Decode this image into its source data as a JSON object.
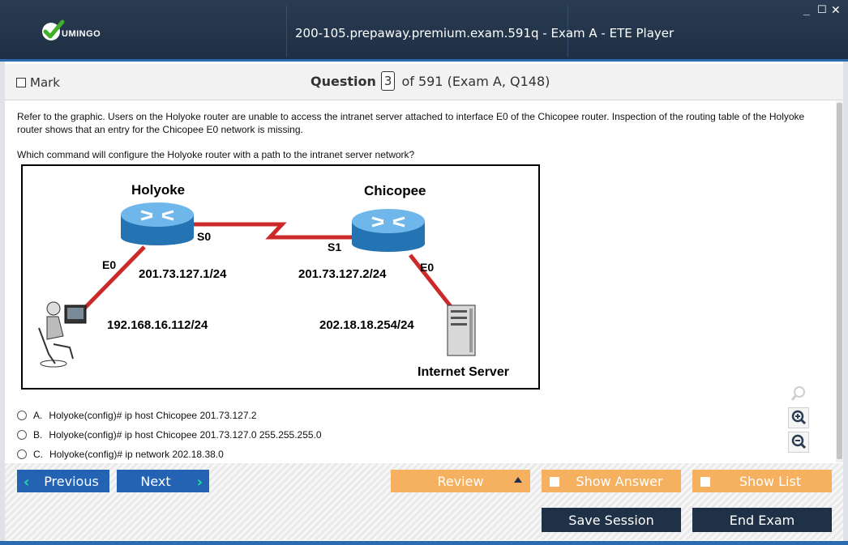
{
  "app": {
    "logo_text": "UMINGO",
    "window_title": "200-105.prepaway.premium.exam.591q - Exam A - ETE Player",
    "controls": {
      "minimize": "_",
      "maximize": "☐",
      "close": "✕"
    }
  },
  "header": {
    "mark_label": "Mark",
    "question_label": "Question",
    "question_number": "3",
    "question_of": "of 591 (Exam A, Q148)"
  },
  "question": {
    "text": "Refer to the graphic. Users on the Holyoke router are unable to access the intranet server attached to interface E0 of the Chicopee router. Inspection of the routing table of the Holyoke router shows that an entry for the Chicopee E0 network is missing.",
    "prompt": "Which command will configure the Holyoke router with a path to the intranet server network?"
  },
  "diagram": {
    "router1_name": "Holyoke",
    "router2_name": "Chicopee",
    "r1_serial": "S0",
    "r2_serial": "S1",
    "r1_eth": "E0",
    "r2_eth": "E0",
    "r1_serial_ip": "201.73.127.1/24",
    "r2_serial_ip": "201.73.127.2/24",
    "host_ip": "192.168.16.112/24",
    "server_gw_ip": "202.18.18.254/24",
    "server_label": "Internet Server"
  },
  "answers": [
    {
      "letter": "A.",
      "text": "Holyoke(config)# ip host Chicopee 201.73.127.2"
    },
    {
      "letter": "B.",
      "text": "Holyoke(config)# ip host Chicopee 201.73.127.0 255.255.255.0"
    },
    {
      "letter": "C.",
      "text": "Holyoke(config)# ip network 202.18.38.0"
    }
  ],
  "footer": {
    "previous": "Previous",
    "next": "Next",
    "review": "Review",
    "show_answer": "Show Answer",
    "show_list": "Show List",
    "save_session": "Save Session",
    "end_exam": "End Exam"
  },
  "icons": {
    "logo": "checkmark-logo-icon",
    "zoom_fit": "magnifier-icon",
    "zoom_in": "zoom-in-icon",
    "zoom_out": "zoom-out-icon"
  },
  "colors": {
    "titlebar": "#1f3045",
    "accent": "#2b6cb0",
    "nav_button": "#2463b4",
    "orange_button": "#f5b060",
    "dark_button": "#1f3146",
    "link_red": "#cc2a2a",
    "router_blue": "#2f8ccf"
  }
}
